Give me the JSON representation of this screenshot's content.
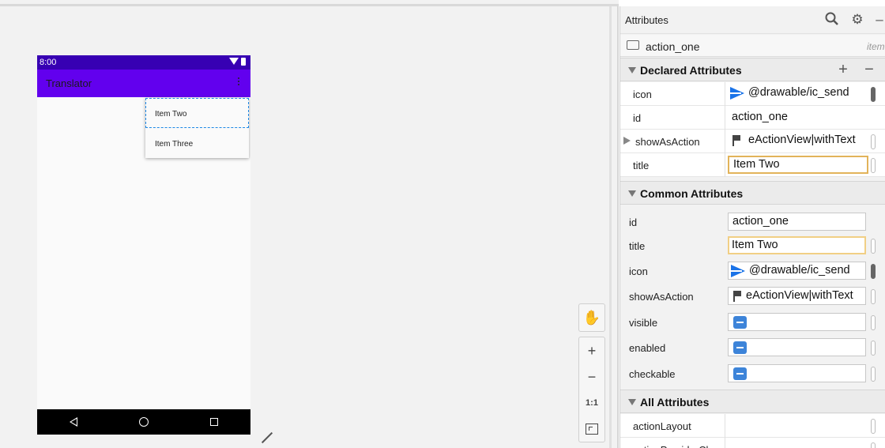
{
  "device": {
    "status_time": "8:00",
    "app_title": "Translator",
    "menu_items": [
      "Item Two",
      "Item Three"
    ]
  },
  "zoom": {
    "zoom_in": "+",
    "zoom_out": "−",
    "actual_size": "1:1"
  },
  "panel": {
    "title": "Attributes",
    "component_name": "action_one",
    "component_type": "item",
    "declared": {
      "header": "Declared Attributes",
      "rows": [
        {
          "key": "icon",
          "value": "@drawable/ic_send"
        },
        {
          "key": "id",
          "value": "action_one"
        },
        {
          "key": "showAsAction",
          "value": "eActionView|withText"
        },
        {
          "key": "title",
          "value": "Item Two"
        }
      ]
    },
    "common": {
      "header": "Common Attributes",
      "rows": [
        {
          "key": "id",
          "value": "action_one"
        },
        {
          "key": "title",
          "value": "Item Two"
        },
        {
          "key": "icon",
          "value": "@drawable/ic_send"
        },
        {
          "key": "showAsAction",
          "value": "eActionView|withText"
        },
        {
          "key": "visible",
          "value": ""
        },
        {
          "key": "enabled",
          "value": ""
        },
        {
          "key": "checkable",
          "value": ""
        }
      ]
    },
    "all": {
      "header": "All Attributes",
      "rows": [
        {
          "key": "actionLayout",
          "value": ""
        },
        {
          "key": "actionProviderCl",
          "value": ""
        }
      ]
    }
  },
  "colors": {
    "primary": "#6200ee",
    "primary_dark": "#3700b3",
    "selection": "#1e88e5",
    "focus": "#e2b35a",
    "checkbox": "#3d84d9"
  }
}
